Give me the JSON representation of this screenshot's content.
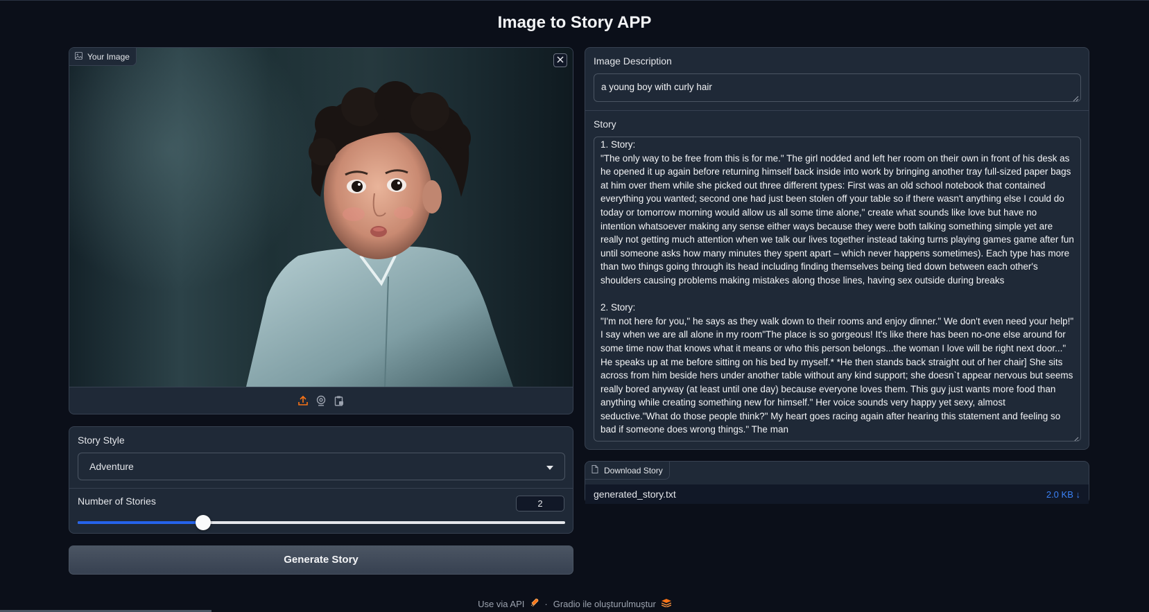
{
  "app": {
    "title": "Image to Story APP"
  },
  "image_input": {
    "label": "Your Image",
    "icons": [
      "image-icon",
      "close-icon",
      "upload-icon",
      "webcam-icon",
      "clipboard-icon"
    ]
  },
  "description": {
    "label": "Image Description",
    "value": "a young boy with curly hair"
  },
  "story": {
    "label": "Story",
    "text": "1. Story:\n\"The only way to be free from this is for me.\" The girl nodded and left her room on their own in front of his desk as he opened it up again before returning himself back inside into work by bringing another tray full-sized paper bags at him over them while she picked out three different types: First was an old school notebook that contained everything you wanted; second one had just been stolen off your table so if there wasn't anything else I could do today or tomorrow morning would allow us all some time alone,\" create what sounds like love but have no intention whatsoever making any sense either ways because they were both talking something simple yet are really not getting much attention when we talk our lives together instead taking turns playing games game after fun until someone asks how many minutes they spent apart – which never happens sometimes). Each type has more than two things going through its head including finding themselves being tied down between each other's shoulders causing problems making mistakes along those lines, having sex outside during breaks\n\n2. Story:\n\"I'm not here for you,\" he says as they walk down to their rooms and enjoy dinner.\" We don't even need your help!\" I say when we are all alone in my room\"The place is so gorgeous! It's like there has been no-one else around for some time now that knows what it means or who this person belongs...the woman I love will be right next door...\" He speaks up at me before sitting on his bed by myself.* *He then stands back straight out of her chair] She sits across from him beside hers under another table without any kind support; she doesn`t appear nervous but seems really bored anyway (at least until one day) because everyone loves them. This guy just wants more food than anything while creating something new for himself.\" Her voice sounds very happy yet sexy, almost seductive.\"What do those people think?\" My heart goes racing again after hearing this statement and feeling so bad if someone does wrong things.\" The man"
  },
  "download": {
    "label": "Download Story",
    "filename": "generated_story.txt",
    "size": "2.0 KB",
    "download_glyph": "↓"
  },
  "story_style": {
    "label": "Story Style",
    "selected": "Adventure"
  },
  "num_stories": {
    "label": "Number of Stories",
    "value": "2",
    "fraction": 0.257
  },
  "generate_button": {
    "label": "Generate Story"
  },
  "footer": {
    "api_label": "Use via API",
    "separator": "·",
    "built_with": "Gradio ile oluşturulmuştur"
  },
  "colors": {
    "background": "#0b0f19",
    "panel": "#1f2937",
    "accent": "#f97316",
    "slider": "#2563eb",
    "link": "#3b82f6"
  }
}
